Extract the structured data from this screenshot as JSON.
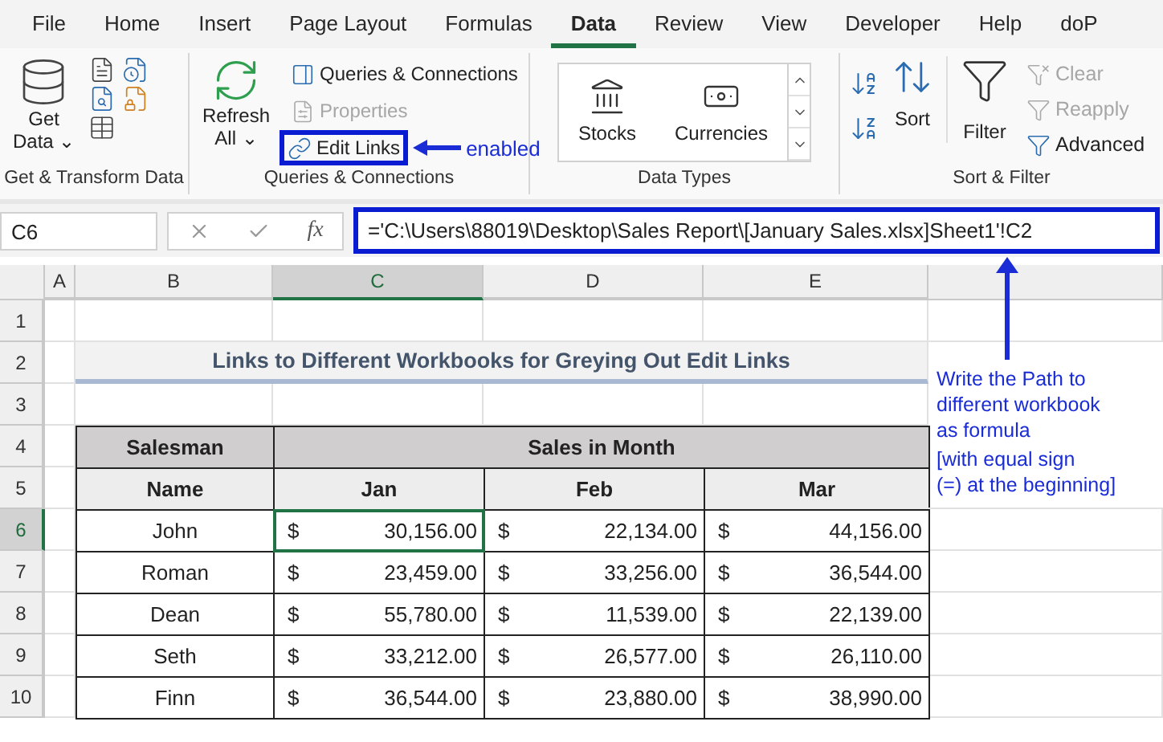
{
  "tabs": [
    {
      "label": "File",
      "selected": false
    },
    {
      "label": "Home",
      "selected": false
    },
    {
      "label": "Insert",
      "selected": false
    },
    {
      "label": "Page Layout",
      "selected": false
    },
    {
      "label": "Formulas",
      "selected": false
    },
    {
      "label": "Data",
      "selected": true
    },
    {
      "label": "Review",
      "selected": false
    },
    {
      "label": "View",
      "selected": false
    },
    {
      "label": "Developer",
      "selected": false
    },
    {
      "label": "Help",
      "selected": false
    },
    {
      "label": "doP",
      "selected": false
    }
  ],
  "get_transform": {
    "button": [
      "Get",
      "Data ⌄"
    ],
    "group_label": "Get & Transform Data"
  },
  "queries": {
    "refresh": [
      "Refresh",
      "All ⌄"
    ],
    "items": [
      {
        "label": "Queries & Connections",
        "disabled": false,
        "highlighted": false
      },
      {
        "label": "Properties",
        "disabled": true,
        "highlighted": false
      },
      {
        "label": "Edit Links",
        "disabled": false,
        "highlighted": true
      }
    ],
    "callout": "enabled",
    "group_label": "Queries & Connections"
  },
  "data_types": {
    "items": [
      "Stocks",
      "Currencies"
    ],
    "group_label": "Data Types"
  },
  "sort_filter": {
    "sort": "Sort",
    "filter": "Filter",
    "items": [
      {
        "label": "Clear",
        "disabled": true
      },
      {
        "label": "Reapply",
        "disabled": true
      },
      {
        "label": "Advanced",
        "disabled": false
      }
    ],
    "group_label": "Sort & Filter"
  },
  "formula_bar": {
    "name_box": "C6",
    "fx": "fx",
    "formula": "='C:\\Users\\88019\\Desktop\\Sales Report\\[January Sales.xlsx]Sheet1'!C2"
  },
  "columns": [
    {
      "label": "A",
      "selected": false
    },
    {
      "label": "B",
      "selected": false
    },
    {
      "label": "C",
      "selected": true
    },
    {
      "label": "D",
      "selected": false
    },
    {
      "label": "E",
      "selected": false
    }
  ],
  "rows": [
    {
      "label": "1",
      "selected": false
    },
    {
      "label": "2",
      "selected": false
    },
    {
      "label": "3",
      "selected": false
    },
    {
      "label": "4",
      "selected": false
    },
    {
      "label": "5",
      "selected": false
    },
    {
      "label": "6",
      "selected": true
    },
    {
      "label": "7",
      "selected": false
    },
    {
      "label": "8",
      "selected": false
    },
    {
      "label": "9",
      "selected": false
    },
    {
      "label": "10",
      "selected": false
    }
  ],
  "sheet": {
    "title": "Links to Different Workbooks for Greying Out Edit Links",
    "header_top": [
      "Salesman",
      "Sales in Month"
    ],
    "header_sub": [
      "Name",
      "Jan",
      "Feb",
      "Mar"
    ],
    "data": [
      {
        "name": "John",
        "cells": [
          {
            "symbol": "$",
            "amount": "30,156.00",
            "selected": true
          },
          {
            "symbol": "$",
            "amount": "22,134.00",
            "selected": false
          },
          {
            "symbol": "$",
            "amount": "44,156.00",
            "selected": false
          }
        ]
      },
      {
        "name": "Roman",
        "cells": [
          {
            "symbol": "$",
            "amount": "23,459.00",
            "selected": false
          },
          {
            "symbol": "$",
            "amount": "33,256.00",
            "selected": false
          },
          {
            "symbol": "$",
            "amount": "36,544.00",
            "selected": false
          }
        ]
      },
      {
        "name": "Dean",
        "cells": [
          {
            "symbol": "$",
            "amount": "55,780.00",
            "selected": false
          },
          {
            "symbol": "$",
            "amount": "11,539.00",
            "selected": false
          },
          {
            "symbol": "$",
            "amount": "22,139.00",
            "selected": false
          }
        ]
      },
      {
        "name": "Seth",
        "cells": [
          {
            "symbol": "$",
            "amount": "33,212.00",
            "selected": false
          },
          {
            "symbol": "$",
            "amount": "26,577.00",
            "selected": false
          },
          {
            "symbol": "$",
            "amount": "26,110.00",
            "selected": false
          }
        ]
      },
      {
        "name": "Finn",
        "cells": [
          {
            "symbol": "$",
            "amount": "36,544.00",
            "selected": false
          },
          {
            "symbol": "$",
            "amount": "23,880.00",
            "selected": false
          },
          {
            "symbol": "$",
            "amount": "38,990.00",
            "selected": false
          }
        ]
      }
    ]
  },
  "note": {
    "lines": [
      "Write the Path to",
      "different workbook",
      "as formula"
    ],
    "sub_lines": [
      "[with equal sign",
      "(=) at the beginning]"
    ]
  }
}
